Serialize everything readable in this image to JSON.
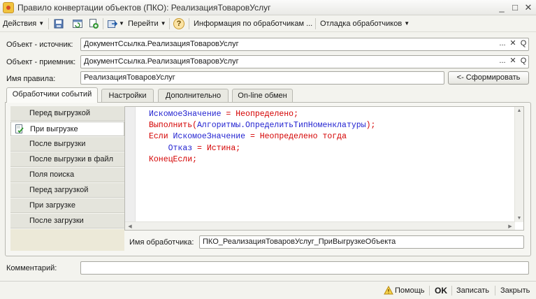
{
  "window": {
    "title": "Правило конвертации объектов (ПКО): РеализацияТоваровУслуг",
    "minimize": "_",
    "maximize": "□",
    "close": "✕"
  },
  "toolbar": {
    "actions_label": "Действия",
    "goto_label": "Перейти",
    "help_label": "?",
    "handlers_info_label": "Информация по обработчикам ...",
    "debug_label": "Отладка обработчиков"
  },
  "form": {
    "source_label": "Объект - источник:",
    "source_value": "ДокументСсылка.РеализацияТоваровУслуг",
    "target_label": "Объект - приемник:",
    "target_value": "ДокументСсылка.РеализацияТоваровУслуг",
    "rule_name_label": "Имя правила:",
    "rule_name_value": "РеализацияТоваровУслуг",
    "generate_button": "<- Сформировать",
    "choose_btn": "...",
    "clear_btn": "✕",
    "open_btn": "Q"
  },
  "tabs": [
    {
      "label": "Обработчики событий",
      "active": true
    },
    {
      "label": "Настройки",
      "active": false
    },
    {
      "label": "Дополнительно",
      "active": false
    },
    {
      "label": "On-line обмен",
      "active": false
    }
  ],
  "events": [
    {
      "label": "Перед выгрузкой",
      "active": false
    },
    {
      "label": "При выгрузке",
      "active": true
    },
    {
      "label": "После выгрузки",
      "active": false
    },
    {
      "label": "После выгрузки в файл",
      "active": false
    },
    {
      "label": "Поля поиска",
      "active": false
    },
    {
      "label": "Перед загрузкой",
      "active": false
    },
    {
      "label": "При загрузке",
      "active": false
    },
    {
      "label": "После загрузки",
      "active": false
    }
  ],
  "editor": {
    "code": [
      [
        {
          "t": "ИскомоеЗначение",
          "c": "id"
        },
        {
          "t": " = ",
          "c": "kw"
        },
        {
          "t": "Неопределено",
          "c": "kw"
        },
        {
          "t": ";",
          "c": "kw"
        }
      ],
      [
        {
          "t": "Выполнить(",
          "c": "kw"
        },
        {
          "t": "Алгоритмы.ОпределитьТипНоменклатуры",
          "c": "id"
        },
        {
          "t": ");",
          "c": "kw"
        }
      ],
      [
        {
          "t": "Если ",
          "c": "kw"
        },
        {
          "t": "ИскомоеЗначение",
          "c": "id"
        },
        {
          "t": " = Неопределено тогда",
          "c": "kw"
        }
      ],
      [
        {
          "t": "    ",
          "c": "kw"
        },
        {
          "t": "Отказ",
          "c": "id"
        },
        {
          "t": " = Истина;",
          "c": "kw"
        }
      ],
      [
        {
          "t": "КонецЕсли;",
          "c": "kw"
        }
      ]
    ],
    "handler_name_label": "Имя обработчика:",
    "handler_name_value": "ПКО_РеализацияТоваровУслуг_ПриВыгрузкеОбъекта"
  },
  "comment_label": "Комментарий:",
  "comment_value": "",
  "footer": {
    "help_label": "Помощь",
    "ok_label": "OK",
    "save_label": "Записать",
    "close_label": "Закрыть"
  },
  "colors": {
    "keyword": "#d40000",
    "identifier": "#1f1fd0",
    "background": "#f3f3ee"
  }
}
